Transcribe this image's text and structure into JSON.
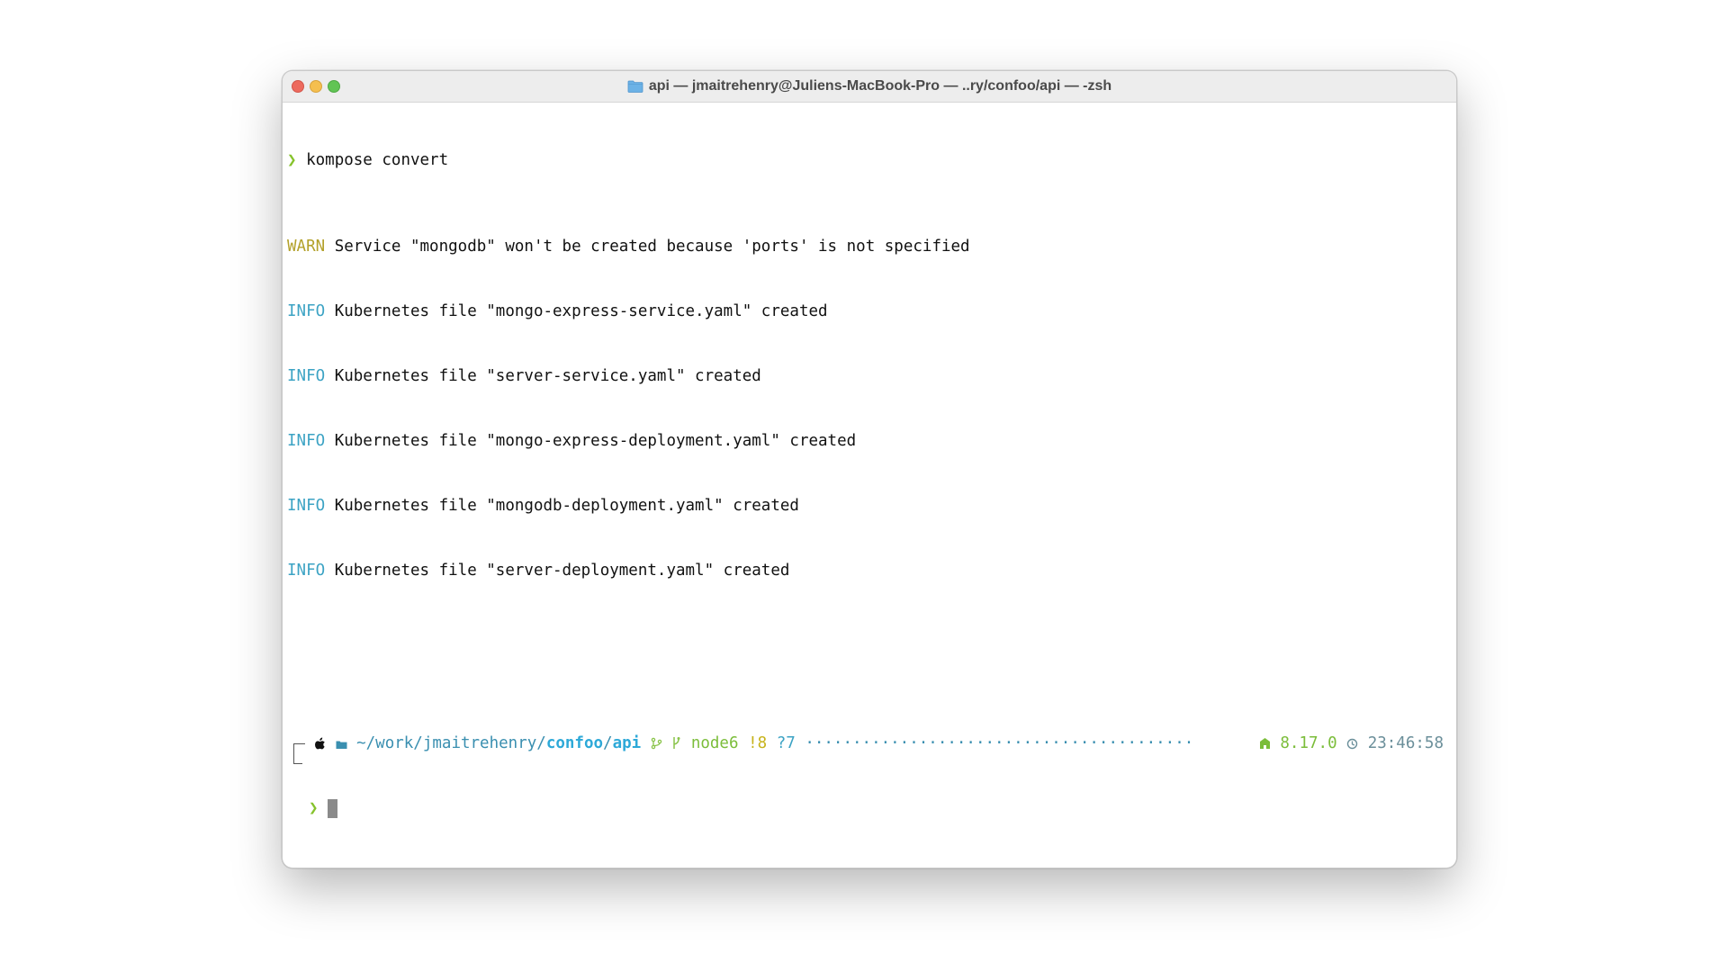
{
  "window": {
    "title": "api — jmaitrehenry@Juliens-MacBook-Pro — ..ry/confoo/api — -zsh",
    "title_icon": "folder-icon"
  },
  "terminal": {
    "command_prompt_symbol": "❯",
    "command": "kompose convert",
    "output": [
      {
        "level": "WARN",
        "message": " Service \"mongodb\" won't be created because 'ports' is not specified"
      },
      {
        "level": "INFO",
        "message": " Kubernetes file \"mongo-express-service.yaml\" created"
      },
      {
        "level": "INFO",
        "message": " Kubernetes file \"server-service.yaml\" created"
      },
      {
        "level": "INFO",
        "message": " Kubernetes file \"mongo-express-deployment.yaml\" created"
      },
      {
        "level": "INFO",
        "message": " Kubernetes file \"mongodb-deployment.yaml\" created"
      },
      {
        "level": "INFO",
        "message": " Kubernetes file \"server-deployment.yaml\" created"
      }
    ],
    "prompt": {
      "path_prefix": "~/work/jmaitrehenry/",
      "path_dir1": "confoo",
      "path_sep": "/",
      "path_dir2": "api",
      "git_branch": "node6",
      "git_modified": "!8",
      "git_untracked": "?7",
      "dots": "·········································",
      "node_version": "8.17.0",
      "time": "23:46:58",
      "second_line_symbol": "❯"
    },
    "icons": {
      "os": "apple-icon",
      "dir": "folder-icon",
      "git": "git-icon",
      "branch": "branch-icon",
      "node": "node-icon",
      "clock": "clock-icon"
    }
  },
  "colors": {
    "prompt_green": "#86c32c",
    "warn": "#b3a12a",
    "info": "#3ca3c4",
    "path": "#3a8fb0"
  }
}
